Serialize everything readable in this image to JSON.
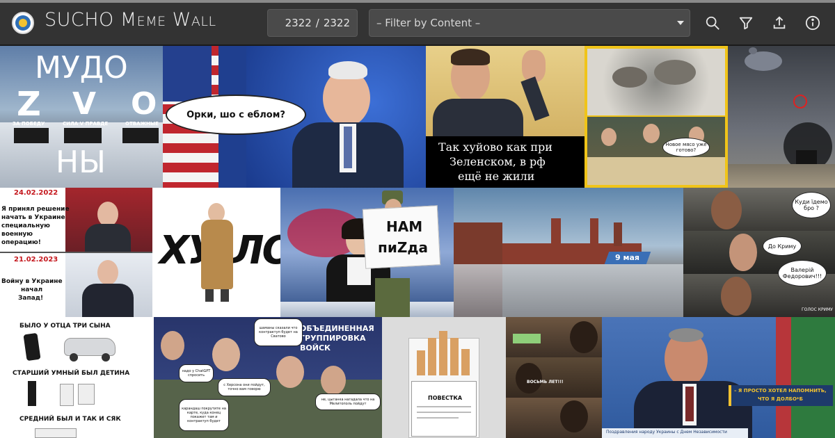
{
  "header": {
    "title": "SUCHO Meme Wall",
    "counter_current": "2322",
    "counter_separator": "/",
    "counter_total": "2322",
    "filter_placeholder": "– Filter by Content –",
    "icons": [
      "search-icon",
      "filter-icon",
      "upload-icon",
      "info-icon"
    ]
  },
  "memes": {
    "m1": {
      "top": "МУДО",
      "letters": [
        "Z",
        "V",
        "O"
      ],
      "captions": [
        "ЗА ПОБЕДУ",
        "СИЛА V ПРАВДЕ",
        "ОТВАЖНЫЕ"
      ],
      "bottom": "НЫ"
    },
    "m2": {
      "bubble": "Орки, шо с еблом?"
    },
    "m3": {
      "caption_l1": "Так хуйово как при",
      "caption_l2": "Зеленском, в рф",
      "caption_l3": "ещё не жили"
    },
    "m4": {
      "bubble": "Новое мясо уже готово?"
    },
    "m6": {
      "date1": "24.02.2022",
      "text1_l1": "Я принял решение",
      "text1_l2": "начать в Украине",
      "text1_l3": "специальную",
      "text1_l4": "военную",
      "text1_l5": "операцию!",
      "date2": "21.02.2023",
      "text2_l1": "Войну в Украине",
      "text2_l2": "начал",
      "text2_l3": "Запад!"
    },
    "m7": {
      "word_left": "ХУ",
      "word_right": "ЛО"
    },
    "m8": {
      "sign_l1": "НАМ",
      "sign_l2": "пиZда"
    },
    "m9": {
      "banner": "9 мая"
    },
    "m10": {
      "bubble1": "Куди їдемо бро ?",
      "bubble2": "До Криму",
      "bubble3": "Валерій Федорович!!!",
      "watermark": "ГОЛОС КРИМУ"
    },
    "m11": {
      "line1": "БЫЛО У ОТЦА ТРИ СЫНА",
      "line2": "СТАРШИЙ УМНЫЙ БЫЛ ДЕТИНА",
      "line3": "СРЕДНИЙ БЫЛ И ТАК И СЯК"
    },
    "m12": {
      "banner": "ОБЪЕДИНЕННАЯ ГРУППИРОВКА ВОЙСК",
      "b1": "шаманы сказали что контрактуп будет на Сватово",
      "b2": "надо у ChatGPT спросить",
      "b3": "с Херсона они пойдут, точно вам говорю",
      "b4": "карандаш покрутите на карте, куда конец покажет там и контрактуп будет",
      "b5": "не, цыганка нагадала что на Мелитополь пойдут"
    },
    "m13": {
      "paper": "ПОВЕСТКА"
    },
    "m14": {
      "caption": "ВОСЬМЬ ЛЕТ!!!"
    },
    "m15": {
      "caption_l1": "– Я ПРОСТО ХОТЕЛ НАПОМНИТЬ,",
      "caption_l2": "ЧТО Я ДОЛБО*Б",
      "sub": "Поздравления народу Украины с Днем Независимости"
    }
  },
  "colors": {
    "topbar": "#333333",
    "field": "#4a4a4a",
    "accent_yellow": "#f2c230",
    "accent_blue": "#2f6fb6"
  }
}
